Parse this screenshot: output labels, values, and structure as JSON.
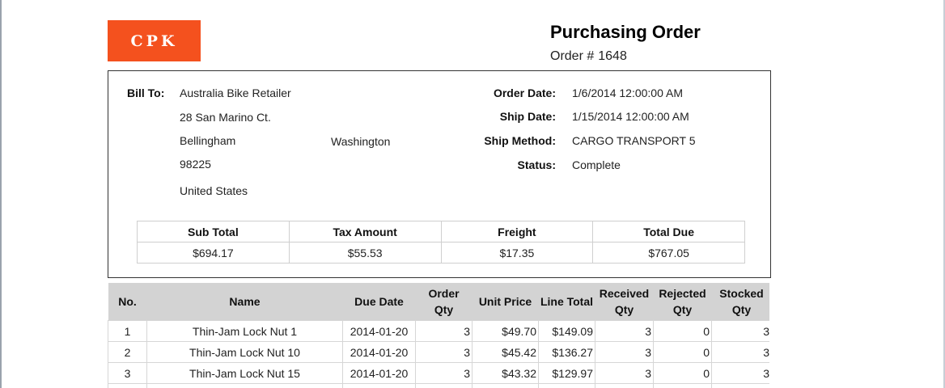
{
  "logo": {
    "text": "CPK"
  },
  "header": {
    "title": "Purchasing Order",
    "order_label": "Order #",
    "order_number": "1648"
  },
  "bill_to": {
    "label": "Bill To:",
    "name": "Australia Bike Retailer",
    "street": "28 San Marino Ct.",
    "city": "Bellingham",
    "state": "Washington",
    "postal": "98225",
    "country": "United States"
  },
  "order_info": {
    "order_date_label": "Order Date:",
    "order_date": "1/6/2014 12:00:00 AM",
    "ship_date_label": "Ship Date:",
    "ship_date": "1/15/2014 12:00:00 AM",
    "ship_method_label": "Ship Method:",
    "ship_method": "CARGO TRANSPORT 5",
    "status_label": "Status:",
    "status": "Complete"
  },
  "totals": {
    "headers": [
      "Sub Total",
      "Tax Amount",
      "Freight",
      "Total Due"
    ],
    "values": [
      "$694.17",
      "$55.53",
      "$17.35",
      "$767.05"
    ]
  },
  "items": {
    "headers": {
      "no": "No.",
      "name": "Name",
      "due_date": "Due Date",
      "order_qty_1": "Order",
      "order_qty_2": "Qty",
      "unit_price": "Unit Price",
      "line_total": "Line Total",
      "received_1": "Received",
      "received_2": "Qty",
      "rejected_1": "Rejected",
      "rejected_2": "Qty",
      "stocked_1": "Stocked",
      "stocked_2": "Qty"
    },
    "rows": [
      {
        "no": "1",
        "name": "Thin-Jam Lock Nut 1",
        "due_date": "2014-01-20",
        "order_qty": "3",
        "unit_price": "$49.70",
        "line_total": "$149.09",
        "received_qty": "3",
        "rejected_qty": "0",
        "stocked_qty": "3"
      },
      {
        "no": "2",
        "name": "Thin-Jam Lock Nut 10",
        "due_date": "2014-01-20",
        "order_qty": "3",
        "unit_price": "$45.42",
        "line_total": "$136.27",
        "received_qty": "3",
        "rejected_qty": "0",
        "stocked_qty": "3"
      },
      {
        "no": "3",
        "name": "Thin-Jam Lock Nut 15",
        "due_date": "2014-01-20",
        "order_qty": "3",
        "unit_price": "$43.32",
        "line_total": "$129.97",
        "received_qty": "3",
        "rejected_qty": "0",
        "stocked_qty": "3"
      },
      {
        "no": "",
        "name": "",
        "due_date": "",
        "order_qty": "",
        "unit_price": "",
        "line_total": "",
        "received_qty": "",
        "rejected_qty": "",
        "stocked_qty": ""
      }
    ]
  }
}
